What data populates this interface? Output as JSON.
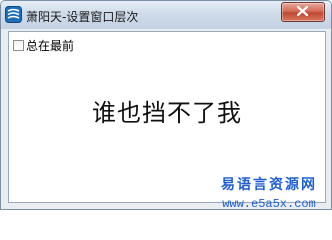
{
  "window": {
    "title": "萧阳天-设置窗口层次",
    "icon": "app-logo-icon",
    "close_icon": "close-icon"
  },
  "controls": {
    "always_on_top_label": "总在最前",
    "always_on_top_checked": false
  },
  "content": {
    "big_text": "谁也挡不了我"
  },
  "watermark": {
    "site_name": "易语言资源网",
    "url": "www.e5a5x.com"
  },
  "colors": {
    "watermark": "#1f5fd1",
    "close_button": "#c9573f"
  }
}
